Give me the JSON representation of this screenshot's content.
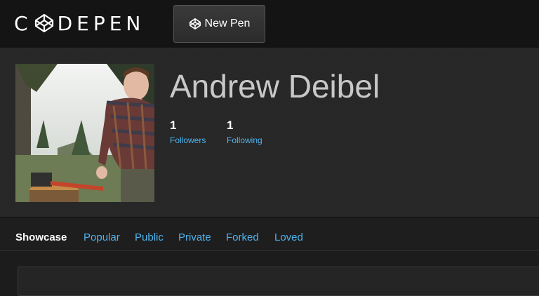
{
  "header": {
    "brand_left": "C",
    "brand_right": "DEPEN",
    "new_pen_label": "New Pen"
  },
  "profile": {
    "name": "Andrew Deibel",
    "followers": {
      "count": "1",
      "label": "Followers"
    },
    "following": {
      "count": "1",
      "label": "Following"
    }
  },
  "tabs": [
    {
      "label": "Showcase",
      "active": true
    },
    {
      "label": "Popular"
    },
    {
      "label": "Public"
    },
    {
      "label": "Private"
    },
    {
      "label": "Forked"
    },
    {
      "label": "Loved"
    }
  ],
  "colors": {
    "link": "#4fb3ee",
    "background": "#1c1c1c",
    "header": "#141414"
  }
}
